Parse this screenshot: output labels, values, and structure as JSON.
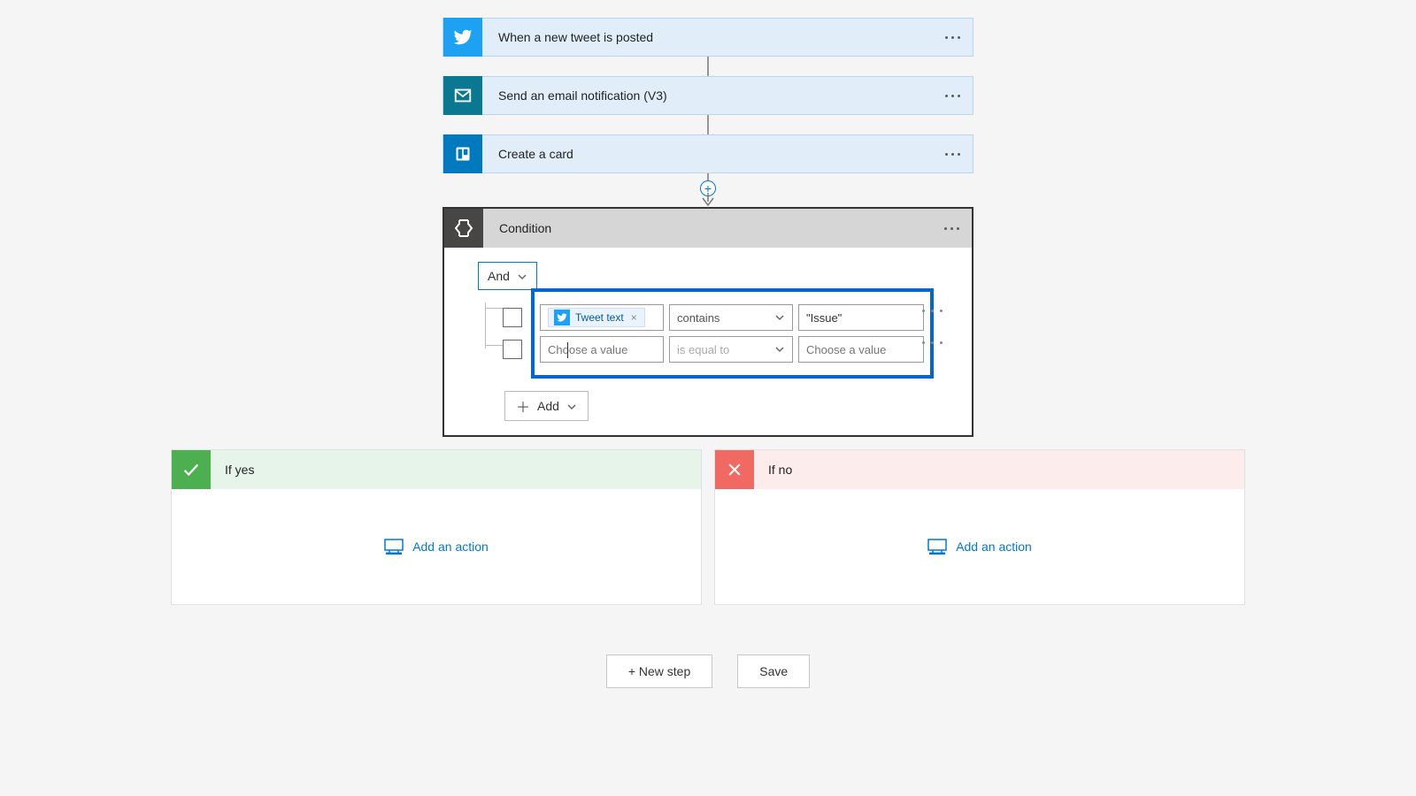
{
  "steps": {
    "twitter_trigger": {
      "title": "When a new tweet is posted"
    },
    "send_email": {
      "title": "Send an email notification (V3)"
    },
    "create_card": {
      "title": "Create a card"
    }
  },
  "condition": {
    "title": "Condition",
    "group_operator": "And",
    "rows": [
      {
        "value_token": "Tweet text",
        "operator": "contains",
        "operator_placeholder": "",
        "right_value": "\"Issue\""
      },
      {
        "value_placeholder": "Choose a value",
        "operator": "",
        "operator_placeholder": "is equal to",
        "right_placeholder": "Choose a value"
      }
    ],
    "add_label": "Add"
  },
  "branches": {
    "yes": {
      "title": "If yes",
      "add_action": "Add an action"
    },
    "no": {
      "title": "If no",
      "add_action": "Add an action"
    }
  },
  "footer": {
    "new_step": "+ New step",
    "save": "Save"
  }
}
